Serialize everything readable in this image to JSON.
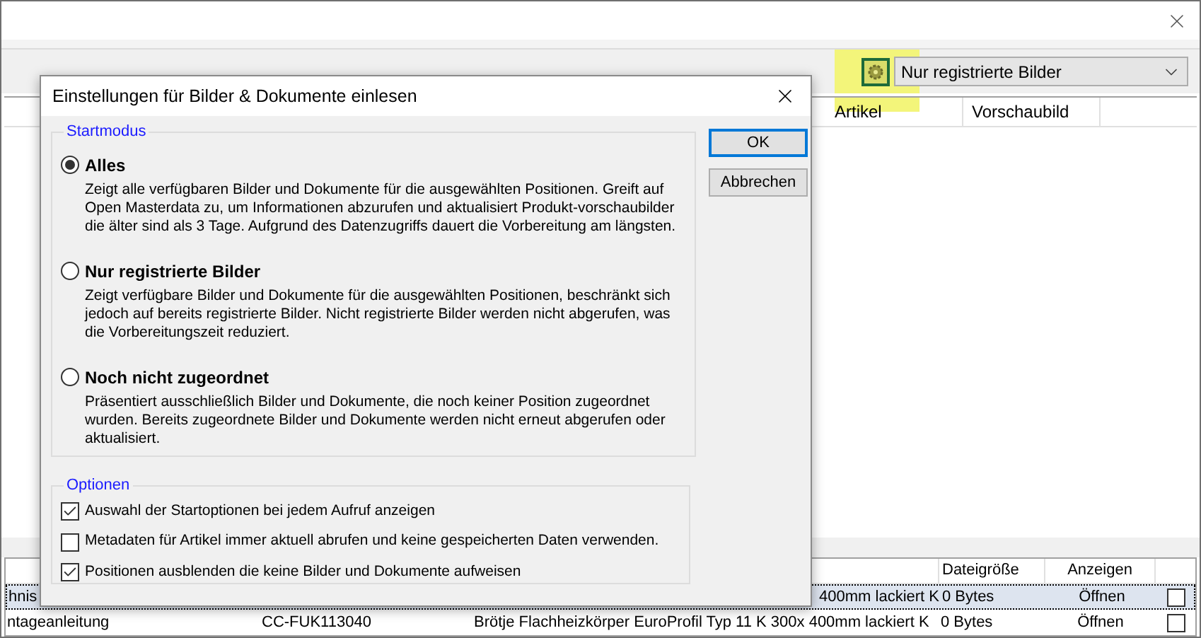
{
  "toolbar": {
    "filter": {
      "value": "Nur registrierte Bilder"
    }
  },
  "top_table": {
    "columns": [
      "Artikel",
      "Vorschaubild"
    ]
  },
  "bottom_table": {
    "columns": [
      "",
      "",
      "",
      "Dateigröße",
      "Anzeigen"
    ],
    "rows": [
      {
        "selected": true,
        "checked": false,
        "cells": [
          "hnis",
          "",
          "400mm lackiert K",
          "0 Bytes",
          "Öffnen"
        ]
      },
      {
        "selected": false,
        "checked": false,
        "cells": [
          "ntageanleitung",
          "CC-FUK113040",
          "Brötje Flachheizkörper EuroProfil Typ 11 K 300x 400mm lackiert K",
          "0 Bytes",
          "Öffnen"
        ]
      }
    ]
  },
  "dialog": {
    "title": "Einstellungen für Bilder & Dokumente einlesen",
    "start_group": {
      "title": "Startmodus",
      "options": [
        {
          "label": "Alles",
          "selected": true,
          "description": "Zeigt alle verfügbaren Bilder und Dokumente für die ausgewählten Positionen. Greift auf Open Masterdata zu, um Informationen abzurufen und aktualisiert Produkt-vorschaubilder die älter sind als 3 Tage.  Aufgrund des Datenzugriffs dauert die Vorbereitung am längsten."
        },
        {
          "label": "Nur registrierte Bilder",
          "selected": false,
          "description": "Zeigt verfügbare Bilder und Dokumente für die ausgewählten Positionen, beschränkt sich jedoch auf bereits  registrierte Bilder. Nicht registrierte Bilder werden nicht abgerufen, was die Vorbereitungszeit reduziert."
        },
        {
          "label": "Noch nicht zugeordnet",
          "selected": false,
          "description": "Präsentiert ausschließlich Bilder und Dokumente, die noch keiner Position zugeordnet wurden. Bereits zugeordnete Bilder und Dokumente werden nicht erneut abgerufen oder aktualisiert."
        }
      ]
    },
    "options_group": {
      "title": "Optionen",
      "options": [
        {
          "label": "Auswahl der Startoptionen bei jedem Aufruf anzeigen",
          "checked": true
        },
        {
          "label": "Metadaten für Artikel immer aktuell abrufen und keine gespeicherten Daten verwenden.",
          "checked": false
        },
        {
          "label": "Positionen ausblenden die keine Bilder und Dokumente aufweisen",
          "checked": true
        }
      ]
    },
    "buttons": [
      {
        "label": "OK",
        "default": true
      },
      {
        "label": "Abbrechen",
        "default": false
      }
    ]
  }
}
